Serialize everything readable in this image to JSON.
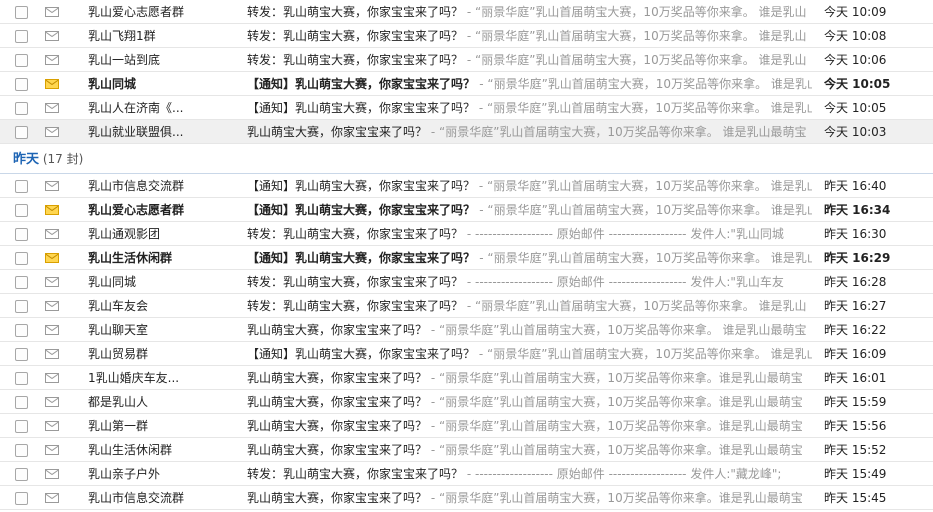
{
  "group_today": {
    "rows": [
      {
        "sender": "乳山爱心志愿者群",
        "subject": "转发：乳山萌宝大赛，你家宝宝来了吗？",
        "separator": "-",
        "snippet": "“丽景华庭”乳山首届萌宝大赛，10万奖品等你来拿。 谁是乳山",
        "date": "今天 10:09",
        "unread": false
      },
      {
        "sender": "乳山飞翔1群",
        "subject": "转发：乳山萌宝大赛，你家宝宝来了吗？",
        "separator": "-",
        "snippet": "“丽景华庭”乳山首届萌宝大赛，10万奖品等你来拿。 谁是乳山",
        "date": "今天 10:08",
        "unread": false
      },
      {
        "sender": "乳山一站到底",
        "subject": "转发：乳山萌宝大赛，你家宝宝来了吗？",
        "separator": "-",
        "snippet": "“丽景华庭”乳山首届萌宝大赛，10万奖品等你来拿。 谁是乳山",
        "date": "今天 10:06",
        "unread": false
      },
      {
        "sender": "乳山同城",
        "subject": "【通知】乳山萌宝大赛，你家宝宝来了吗？",
        "separator": "-",
        "snippet": "“丽景华庭”乳山首届萌宝大赛，10万奖品等你来拿。 谁是乳山",
        "date": "今天 10:05",
        "unread": true
      },
      {
        "sender": "乳山人在济南《...",
        "subject": "【通知】乳山萌宝大赛，你家宝宝来了吗？",
        "separator": "-",
        "snippet": "“丽景华庭”乳山首届萌宝大赛，10万奖品等你来拿。 谁是乳山",
        "date": "今天 10:05",
        "unread": false
      },
      {
        "sender": "乳山就业联盟俱...",
        "subject": "乳山萌宝大赛，你家宝宝来了吗？",
        "separator": "-",
        "snippet": "“丽景华庭”乳山首届萌宝大赛，10万奖品等你来拿。 谁是乳山最萌宝",
        "date": "今天 10:03",
        "unread": false,
        "selected": true
      }
    ]
  },
  "group_yesterday": {
    "title": "昨天",
    "count": "(17 封)",
    "rows": [
      {
        "sender": "乳山市信息交流群",
        "subject": "【通知】乳山萌宝大赛，你家宝宝来了吗？",
        "separator": "-",
        "snippet": "“丽景华庭”乳山首届萌宝大赛，10万奖品等你来拿。 谁是乳山",
        "date": "昨天 16:40",
        "unread": false
      },
      {
        "sender": "乳山爱心志愿者群",
        "subject": "【通知】乳山萌宝大赛，你家宝宝来了吗？",
        "separator": "-",
        "snippet": "“丽景华庭”乳山首届萌宝大赛，10万奖品等你来拿。 谁是乳山",
        "date": "昨天 16:34",
        "unread": true
      },
      {
        "sender": "乳山通观影团",
        "subject": "转发：乳山萌宝大赛，你家宝宝来了吗？",
        "separator": "-",
        "snippet": "------------------ 原始邮件 ------------------ 发件人:\"乳山同城",
        "date": "昨天 16:30",
        "unread": false
      },
      {
        "sender": "乳山生活休闲群",
        "subject": "【通知】乳山萌宝大赛，你家宝宝来了吗？",
        "separator": "-",
        "snippet": "“丽景华庭”乳山首届萌宝大赛，10万奖品等你来拿。 谁是乳山",
        "date": "昨天 16:29",
        "unread": true
      },
      {
        "sender": "乳山同城",
        "subject": "转发：乳山萌宝大赛，你家宝宝来了吗？",
        "separator": "-",
        "snippet": "------------------ 原始邮件 ------------------ 发件人:\"乳山车友",
        "date": "昨天 16:28",
        "unread": false
      },
      {
        "sender": "乳山车友会",
        "subject": "转发：乳山萌宝大赛，你家宝宝来了吗？",
        "separator": "-",
        "snippet": "“丽景华庭”乳山首届萌宝大赛，10万奖品等你来拿。 谁是乳山",
        "date": "昨天 16:27",
        "unread": false
      },
      {
        "sender": "乳山聊天室",
        "subject": "乳山萌宝大赛，你家宝宝来了吗？",
        "separator": "-",
        "snippet": "“丽景华庭”乳山首届萌宝大赛，10万奖品等你来拿。 谁是乳山最萌宝",
        "date": "昨天 16:22",
        "unread": false
      },
      {
        "sender": "乳山贸易群",
        "subject": "【通知】乳山萌宝大赛，你家宝宝来了吗？",
        "separator": "-",
        "snippet": "“丽景华庭”乳山首届萌宝大赛，10万奖品等你来拿。 谁是乳山",
        "date": "昨天 16:09",
        "unread": false
      },
      {
        "sender": "1乳山婚庆车友...",
        "subject": "乳山萌宝大赛，你家宝宝来了吗？",
        "separator": "-",
        "snippet": "“丽景华庭”乳山首届萌宝大赛，10万奖品等你来拿。谁是乳山最萌宝",
        "date": "昨天 16:01",
        "unread": false
      },
      {
        "sender": "都是乳山人",
        "subject": "乳山萌宝大赛，你家宝宝来了吗？",
        "separator": "-",
        "snippet": "“丽景华庭”乳山首届萌宝大赛，10万奖品等你来拿。谁是乳山最萌宝",
        "date": "昨天 15:59",
        "unread": false
      },
      {
        "sender": "乳山第一群",
        "subject": "乳山萌宝大赛，你家宝宝来了吗？",
        "separator": "-",
        "snippet": "“丽景华庭”乳山首届萌宝大赛，10万奖品等你来拿。谁是乳山最萌宝",
        "date": "昨天 15:56",
        "unread": false
      },
      {
        "sender": "乳山生活休闲群",
        "subject": "乳山萌宝大赛，你家宝宝来了吗？",
        "separator": "-",
        "snippet": "“丽景华庭”乳山首届萌宝大赛，10万奖品等你来拿。谁是乳山最萌宝",
        "date": "昨天 15:52",
        "unread": false
      },
      {
        "sender": "乳山亲子户外",
        "subject": "转发：乳山萌宝大赛，你家宝宝来了吗？",
        "separator": "-",
        "snippet": "------------------ 原始邮件 ------------------ 发件人:\"藏龙峰\";",
        "date": "昨天 15:49",
        "unread": false
      },
      {
        "sender": "乳山市信息交流群",
        "subject": "乳山萌宝大赛，你家宝宝来了吗？",
        "separator": "-",
        "snippet": "“丽景华庭”乳山首届萌宝大赛，10万奖品等你来拿。谁是乳山最萌宝",
        "date": "昨天 15:45",
        "unread": false
      }
    ]
  },
  "icons": {
    "checkbox": "checkbox-icon",
    "read_mail": "envelope-icon",
    "unread_mail": "envelope-unread-icon"
  },
  "colors": {
    "group_title": "#1d64b4",
    "unread_envelope": "#ffd650",
    "snippet": "#999999",
    "selected_row": "#f0f0f0"
  }
}
